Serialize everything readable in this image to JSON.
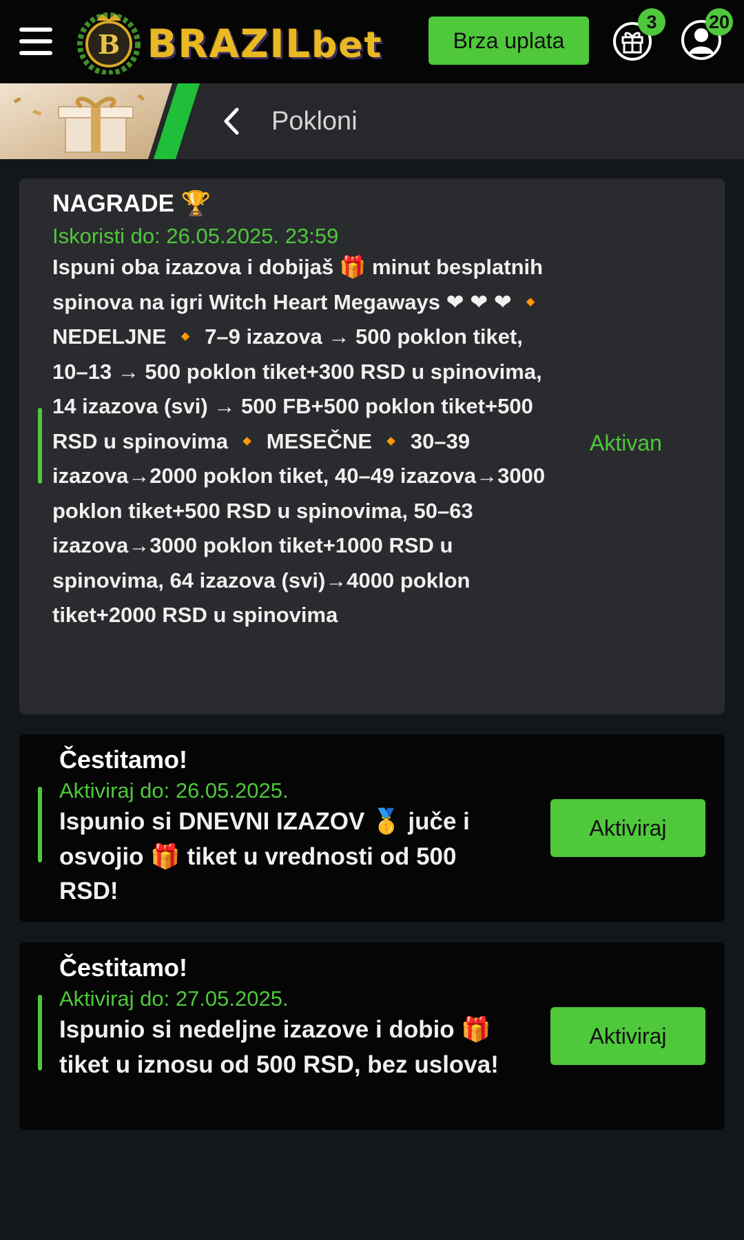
{
  "header": {
    "logo_text_upper": "BRAZIL",
    "logo_text_lower": "bet",
    "deposit_label": "Brza uplata",
    "gift_badge": "3",
    "user_badge": "20",
    "colors": {
      "accent": "#4fc83c",
      "background": "#050505",
      "logo_gold": "#e8b923"
    }
  },
  "subheader": {
    "title": "Pokloni"
  },
  "cards": [
    {
      "title": "NAGRADE 🏆",
      "date": "Iskoristi do: 26.05.2025. 23:59",
      "description": "Ispuni oba izazova i dobijaš 🎁 minut besplatnih spinova na igri Witch Heart Megaways ❤ ❤ ❤ 🔸 NEDELJNE 🔸 7–9 izazova → 500 poklon tiket, 10–13 → 500 poklon tiket+300 RSD u spinovima, 14 izazova (svi) → 500 FB+500 poklon tiket+500 RSD u spinovima 🔸 MESEČNE 🔸 30–39 izazova→2000 poklon tiket, 40–49 izazova→3000 poklon tiket+500 RSD u spinovima, 50–63 izazova→3000 poklon tiket+1000 RSD u spinovima, 64 izazova (svi)→4000 poklon tiket+2000 RSD u spinovima",
      "status": "Aktivan"
    },
    {
      "title": "Čestitamo!",
      "date": "Aktiviraj do: 26.05.2025.",
      "description": "Ispunio si DNEVNI IZAZOV 🥇 juče i osvojio 🎁 tiket u vrednosti od 500 RSD!",
      "button": "Aktiviraj"
    },
    {
      "title": "Čestitamo!",
      "date": "Aktiviraj do: 27.05.2025.",
      "description": "Ispunio si nedeljne izazove i dobio 🎁 tiket u iznosu od 500 RSD, bez uslova!",
      "button": "Aktiviraj"
    }
  ],
  "icons": {
    "menu": "hamburger-icon",
    "gift": "gift-icon",
    "user": "user-icon",
    "back": "chevron-left-icon"
  }
}
